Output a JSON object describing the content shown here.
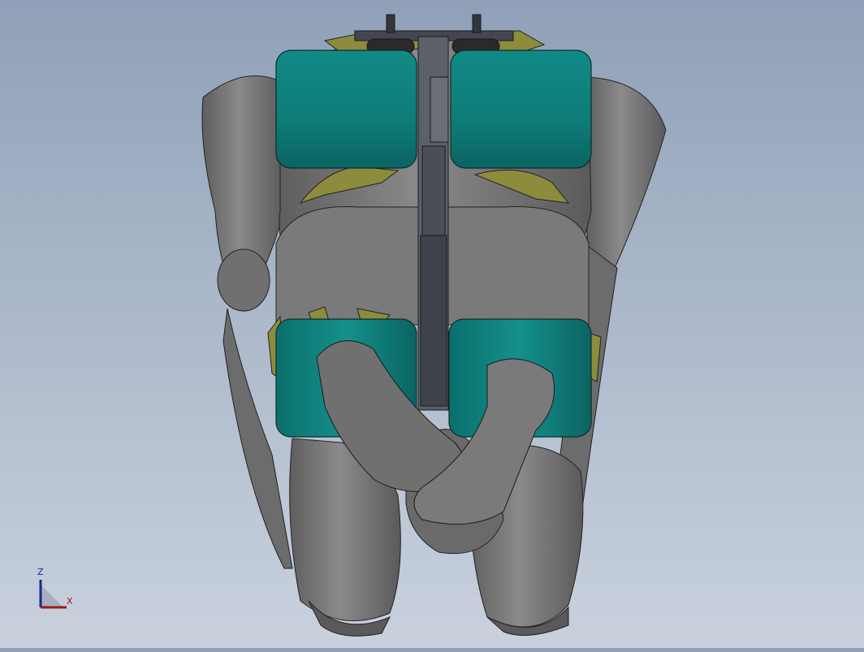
{
  "viewport": {
    "background": "gradient-blue-grey",
    "model_colors": {
      "body": "#7c7c7c",
      "pad_teal": "#0f7d7a",
      "accent_olive": "#8c8c3c",
      "frame_dark": "#44474f"
    }
  },
  "triad": {
    "z_label": "Z",
    "x_label": "X"
  }
}
